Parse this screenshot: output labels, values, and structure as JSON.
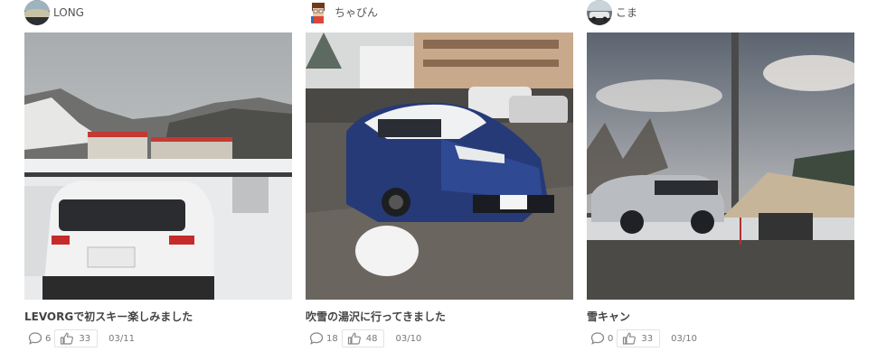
{
  "posts": [
    {
      "user": {
        "name": "LONG"
      },
      "title": "LEVORGで初スキー楽しみました",
      "comments": "6",
      "likes": "33",
      "date": "03/11"
    },
    {
      "user": {
        "name": "ちゃびん"
      },
      "title": "吹雪の湯沢に行ってきました",
      "comments": "18",
      "likes": "48",
      "date": "03/10"
    },
    {
      "user": {
        "name": "こま"
      },
      "title": "雪キャン",
      "comments": "0",
      "likes": "33",
      "date": "03/10"
    }
  ],
  "icons": {
    "comment": "comment-icon",
    "like": "thumbs-up-icon"
  },
  "colors": {
    "text": "#444444",
    "meta": "#777777",
    "border": "#e3e3e3"
  }
}
